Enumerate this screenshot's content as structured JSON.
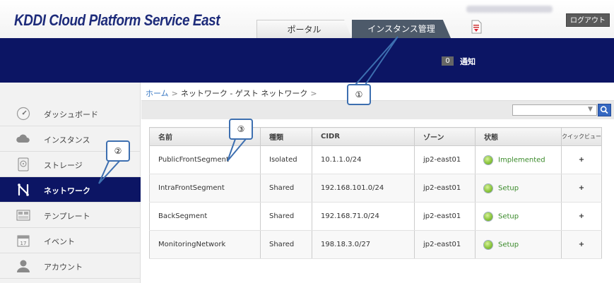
{
  "header": {
    "logo_text": "KDDI Cloud Platform Service East",
    "logout_label": "ログアウト",
    "tabs": [
      {
        "label": "ポータル",
        "active": false
      },
      {
        "label": "インスタンス管理",
        "active": true
      }
    ],
    "pdf_icon": "pdf-download-icon"
  },
  "notifications": {
    "count": "0",
    "label": "通知"
  },
  "sidebar": {
    "items": [
      {
        "label": "ダッシュボード",
        "icon": "gauge-icon",
        "active": false
      },
      {
        "label": "インスタンス",
        "icon": "cloud-icon",
        "active": false
      },
      {
        "label": "ストレージ",
        "icon": "disk-icon",
        "active": false
      },
      {
        "label": "ネットワーク",
        "icon": "network-icon",
        "active": true
      },
      {
        "label": "テンプレート",
        "icon": "template-icon",
        "active": false
      },
      {
        "label": "イベント",
        "icon": "calendar-icon",
        "active": false
      },
      {
        "label": "アカウント",
        "icon": "person-icon",
        "active": false
      }
    ]
  },
  "breadcrumb": {
    "home": "ホーム",
    "separator": ">",
    "current": "ネットワーク - ゲスト ネットワーク"
  },
  "search": {
    "placeholder": "",
    "value": ""
  },
  "table": {
    "headers": [
      "名前",
      "種類",
      "CIDR",
      "ゾーン",
      "状態",
      "クイックビュー"
    ],
    "rows": [
      {
        "name": "PublicFrontSegment",
        "type": "Isolated",
        "cidr": "10.1.1.0/24",
        "zone": "jp2-east01",
        "status": "Implemented"
      },
      {
        "name": "IntraFrontSegment",
        "type": "Shared",
        "cidr": "192.168.101.0/24",
        "zone": "jp2-east01",
        "status": "Setup"
      },
      {
        "name": "BackSegment",
        "type": "Shared",
        "cidr": "192.168.71.0/24",
        "zone": "jp2-east01",
        "status": "Setup"
      },
      {
        "name": "MonitoringNetwork",
        "type": "Shared",
        "cidr": "198.18.3.0/27",
        "zone": "jp2-east01",
        "status": "Setup"
      }
    ],
    "quick_view_symbol": "+"
  },
  "callouts": [
    "①",
    "②",
    "③"
  ],
  "colors": {
    "navy": "#0c1564",
    "status_green": "#8cc63f",
    "callout_border": "#3d6fb0",
    "link_blue": "#3a78c3"
  }
}
